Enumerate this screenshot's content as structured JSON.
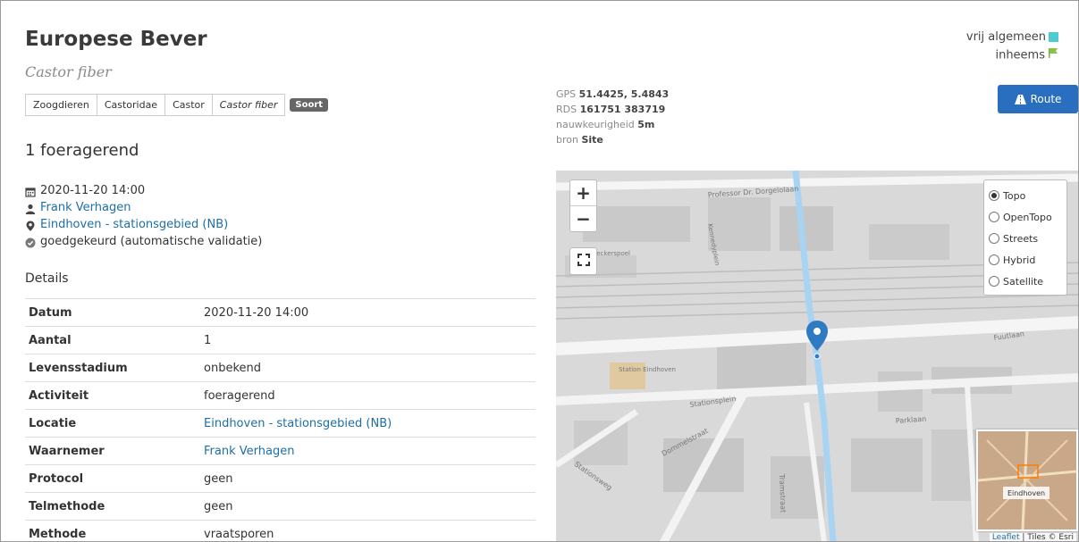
{
  "header": {
    "title": "Europese Bever",
    "scientific_name": "Castor fiber",
    "breadcrumb": [
      "Zoogdieren",
      "Castoridae",
      "Castor",
      "Castor fiber"
    ],
    "rank_badge": "Soort"
  },
  "legend": {
    "status1": "vrij algemeen",
    "status1_color": "#4ecbd1",
    "status2": "inheems",
    "status2_color": "#8bc34a"
  },
  "observation": {
    "title": "1 foeragerend",
    "date": "2020-11-20 14:00",
    "observer": "Frank Verhagen",
    "location": "Eindhoven - stationsgebied (NB)",
    "validation": "goedgekeurd (automatische validatie)"
  },
  "details": {
    "heading": "Details",
    "rows": [
      {
        "key": "Datum",
        "value": "2020-11-20 14:00"
      },
      {
        "key": "Aantal",
        "value": "1"
      },
      {
        "key": "Levensstadium",
        "value": "onbekend"
      },
      {
        "key": "Activiteit",
        "value": "foeragerend"
      },
      {
        "key": "Locatie",
        "value": "Eindhoven - stationsgebied (NB)"
      },
      {
        "key": "Waarnemer",
        "value": "Frank Verhagen"
      },
      {
        "key": "Protocol",
        "value": "geen"
      },
      {
        "key": "Telmethode",
        "value": "geen"
      },
      {
        "key": "Methode",
        "value": "vraatsporen"
      }
    ]
  },
  "coords": {
    "gps_label": "GPS",
    "gps_value": "51.4425, 5.4843",
    "rds_label": "RDS",
    "rds_value": "161751 383719",
    "acc_label": "nauwkeurigheid",
    "acc_value": "5m",
    "src_label": "bron",
    "src_value": "Site"
  },
  "route_button": "Route",
  "map": {
    "zoom_in": "+",
    "zoom_out": "−",
    "layers": [
      "Topo",
      "OpenTopo",
      "Streets",
      "Hybrid",
      "Satellite"
    ],
    "selected_layer": "Topo",
    "street_labels": [
      "Professor Dr. Dorgelolaan",
      "Fuutlaan",
      "Stationsplein",
      "Parklaan",
      "Dommelstraat",
      "Stationsweg",
      "Station Eindhoven",
      "Neckerspoel",
      "Kennedyplein",
      "Tramstraat"
    ],
    "minimap_label": "Eindhoven",
    "attribution_link": "Leaflet",
    "attribution_text": "| Tiles © Esri"
  }
}
